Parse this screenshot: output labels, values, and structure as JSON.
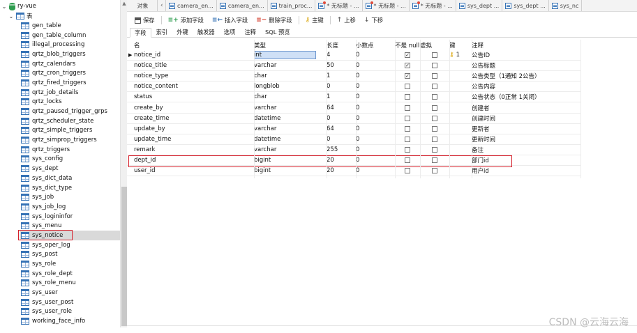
{
  "sidebar": {
    "database": "ry-vue",
    "folder": "表",
    "tables": [
      "gen_table",
      "gen_table_column",
      "illegal_processing",
      "qrtz_blob_triggers",
      "qrtz_calendars",
      "qrtz_cron_triggers",
      "qrtz_fired_triggers",
      "qrtz_job_details",
      "qrtz_locks",
      "qrtz_paused_trigger_grps",
      "qrtz_scheduler_state",
      "qrtz_simple_triggers",
      "qrtz_simprop_triggers",
      "qrtz_triggers",
      "sys_config",
      "sys_dept",
      "sys_dict_data",
      "sys_dict_type",
      "sys_job",
      "sys_job_log",
      "sys_logininfor",
      "sys_menu",
      "sys_notice",
      "sys_oper_log",
      "sys_post",
      "sys_role",
      "sys_role_dept",
      "sys_role_menu",
      "sys_user",
      "sys_user_post",
      "sys_user_role",
      "working_face_info"
    ],
    "selected": "sys_notice"
  },
  "tabs": {
    "objects": "对象",
    "items": [
      "camera_en...",
      "camera_en...",
      "train_proc...",
      "* 无标题 - ...",
      "* 无标题 - ...",
      "* 无标题 - ...",
      "sys_dept ...",
      "sys_dept ...",
      "sys_nc"
    ]
  },
  "toolbar": {
    "save": "保存",
    "add_field": "添加字段",
    "insert_field": "插入字段",
    "delete_field": "删除字段",
    "primary_key": "主键",
    "move_up": "上移",
    "move_down": "下移"
  },
  "subtabs": [
    "字段",
    "索引",
    "外键",
    "触发器",
    "选项",
    "注释",
    "SQL 预览"
  ],
  "columns": {
    "name": "名",
    "type": "类型",
    "length": "长度",
    "decimals": "小数点",
    "not_null": "不是 null",
    "virtual": "虚拟",
    "key": "键",
    "comment": "注释"
  },
  "rows": [
    {
      "name": "notice_id",
      "type": "int",
      "length": "4",
      "decimals": "0",
      "not_null": true,
      "virtual": false,
      "key": "1",
      "comment": "公告ID"
    },
    {
      "name": "notice_title",
      "type": "varchar",
      "length": "50",
      "decimals": "0",
      "not_null": true,
      "virtual": false,
      "key": "",
      "comment": "公告标题"
    },
    {
      "name": "notice_type",
      "type": "char",
      "length": "1",
      "decimals": "0",
      "not_null": true,
      "virtual": false,
      "key": "",
      "comment": "公告类型（1通知 2公告）"
    },
    {
      "name": "notice_content",
      "type": "longblob",
      "length": "0",
      "decimals": "0",
      "not_null": false,
      "virtual": false,
      "key": "",
      "comment": "公告内容"
    },
    {
      "name": "status",
      "type": "char",
      "length": "1",
      "decimals": "0",
      "not_null": false,
      "virtual": false,
      "key": "",
      "comment": "公告状态（0正常 1关闭）"
    },
    {
      "name": "create_by",
      "type": "varchar",
      "length": "64",
      "decimals": "0",
      "not_null": false,
      "virtual": false,
      "key": "",
      "comment": "创建者"
    },
    {
      "name": "create_time",
      "type": "datetime",
      "length": "0",
      "decimals": "0",
      "not_null": false,
      "virtual": false,
      "key": "",
      "comment": "创建时间"
    },
    {
      "name": "update_by",
      "type": "varchar",
      "length": "64",
      "decimals": "0",
      "not_null": false,
      "virtual": false,
      "key": "",
      "comment": "更新者"
    },
    {
      "name": "update_time",
      "type": "datetime",
      "length": "0",
      "decimals": "0",
      "not_null": false,
      "virtual": false,
      "key": "",
      "comment": "更新时间"
    },
    {
      "name": "remark",
      "type": "varchar",
      "length": "255",
      "decimals": "0",
      "not_null": false,
      "virtual": false,
      "key": "",
      "comment": "备注"
    },
    {
      "name": "dept_id",
      "type": "bigint",
      "length": "20",
      "decimals": "0",
      "not_null": false,
      "virtual": false,
      "key": "",
      "comment": "部门id"
    },
    {
      "name": "user_id",
      "type": "bigint",
      "length": "20",
      "decimals": "0",
      "not_null": false,
      "virtual": false,
      "key": "",
      "comment": "用户id"
    }
  ],
  "watermark": "CSDN @云海云海"
}
